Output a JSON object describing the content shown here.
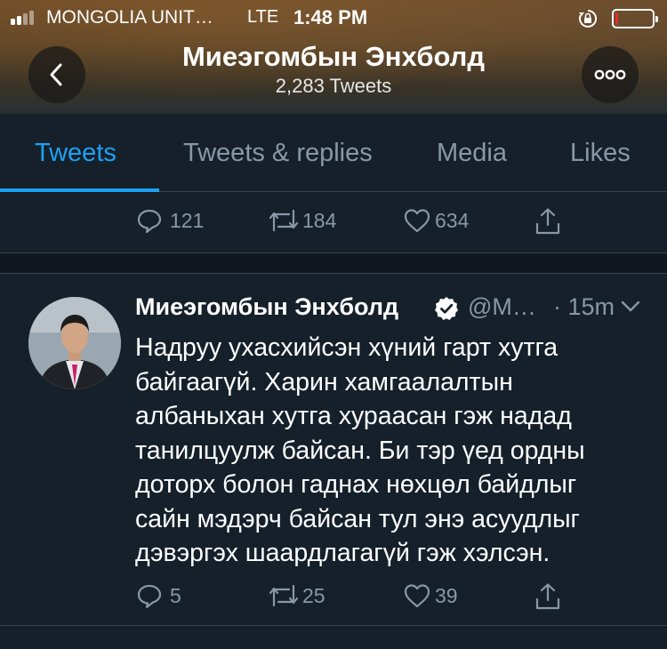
{
  "status_bar": {
    "carrier": "MONGOLIA UNIT…",
    "network": "LTE",
    "time": "1:48 PM",
    "battery_level": 0.08,
    "battery_color": "#e0302a",
    "signal_icon": "signal-bars-icon",
    "lock_icon": "rotation-lock-icon"
  },
  "header": {
    "name": "Миеэгомбын Энхболд",
    "tweet_count": "2,283 Tweets",
    "back_icon": "back-chevron-icon",
    "more_icon": "more-dots-icon"
  },
  "tabs": [
    {
      "label": "Tweets",
      "active": true
    },
    {
      "label": "Tweets & replies",
      "active": false
    },
    {
      "label": "Media",
      "active": false
    },
    {
      "label": "Likes",
      "active": false
    }
  ],
  "previous_tweet": {
    "replies": "121",
    "retweets": "184",
    "likes": "634"
  },
  "tweet": {
    "author": "Миеэгомбын Энхболд",
    "verified": true,
    "handle": "@M…",
    "time": "· 15m",
    "lines": [
      "Надруу ухасхийсэн хүний гарт хутга",
      "байгаагүй. Харин хамгаалалтын",
      "албаныхан хутга хураасан гэж надад",
      "танилцуулж байсан. Би тэр үед ордны",
      "доторх болон гаднах нөхцөл байдлыг",
      "сайн мэдэрч байсан тул энэ асуудлыг",
      "дэвэргэх шаардлагагүй гэж хэлсэн."
    ],
    "replies": "5",
    "retweets": "25",
    "likes": "39"
  },
  "colors": {
    "background": "#15202b",
    "accent": "#1da1f2",
    "secondary_text": "#8899a6",
    "divider": "#38444d"
  }
}
